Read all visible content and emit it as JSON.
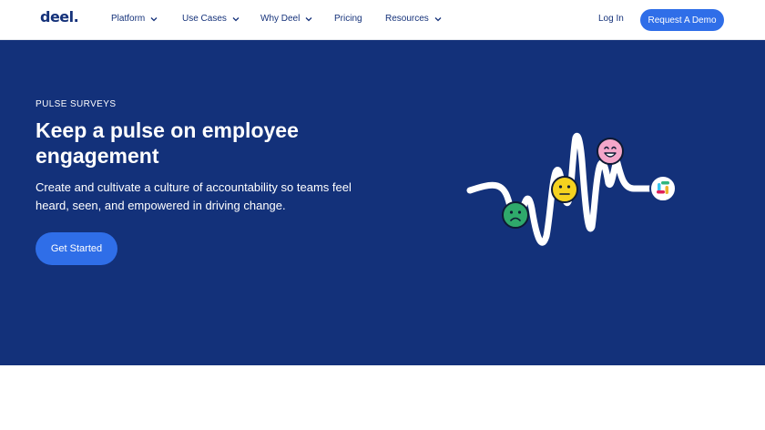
{
  "nav": {
    "logo": "deel.",
    "items": [
      {
        "label": "Platform",
        "dropdown": true
      },
      {
        "label": "Use Cases",
        "dropdown": true
      },
      {
        "label": "Why Deel",
        "dropdown": true
      },
      {
        "label": "Pricing",
        "dropdown": false
      },
      {
        "label": "Resources",
        "dropdown": true
      }
    ],
    "login": "Log In",
    "demo": "Request A Demo"
  },
  "hero": {
    "eyebrow": "PULSE SURVEYS",
    "headline": "Keep a pulse on employee engagement",
    "subtext": "Create and cultivate a culture of accountability so teams feel heard, seen, and empowered in driving change.",
    "cta": "Get Started"
  },
  "icons": [
    "chevron-down-icon",
    "sad-face-icon",
    "neutral-face-icon",
    "happy-face-icon",
    "slack-logo-icon"
  ],
  "colors": {
    "brand_navy": "#13317a",
    "accent_blue": "#2f6ee8",
    "sad_green": "#2fa96b",
    "neutral_yellow": "#f5d21f",
    "happy_pink": "#f4a6c9"
  }
}
